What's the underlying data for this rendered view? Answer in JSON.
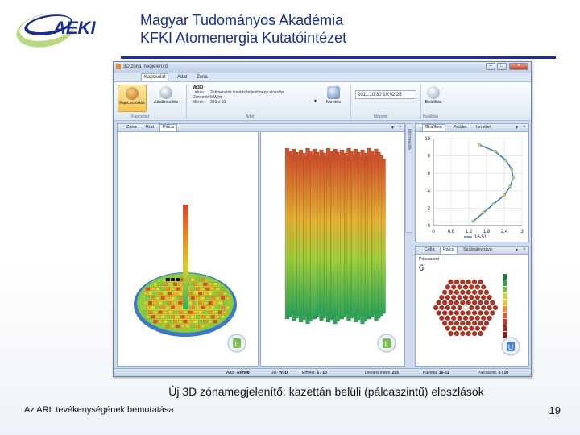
{
  "slide": {
    "logo_text": "AEKI",
    "title_line1": "Magyar Tudományos Akadémia",
    "title_line2": "KFKI Atomenergia Kutatóintézet",
    "caption": "Új 3D zónamegjelenítő: kazettán belüli (pálcaszintű) eloszlások",
    "footer_left": "Az ARL tevékenységének bemutatása",
    "page_number": "19"
  },
  "app": {
    "window_title": "3D zóna megjelenítő",
    "window_buttons": {
      "minimize": "–",
      "maximize": "□",
      "close": "×"
    },
    "menu": {
      "tabs": [
        "Kapcsolat",
        "Adat",
        "Zóna"
      ],
      "active_index": 0
    },
    "ribbon": {
      "kapcsolat_button": "Kapcsolódás",
      "kapcsolat_button2": "Adatfrissítés",
      "w3d": {
        "title": "W3D",
        "leiras_key": "Leírás:",
        "leiras_val": "3 dimenziós lineáris teljesítmény eloszlás",
        "dimenzio_key": "Dimenzió:",
        "dimenzio_val": "MW/m",
        "meret_key": "Méret:",
        "meret_val": "349 x 10"
      },
      "save_button": "Mentés",
      "timestamp": "2011.10.30 10:02:28",
      "settings_button": "Beállítás",
      "groups": [
        "Kapcsolat",
        "Adat",
        "Időpont",
        "Beállítás"
      ]
    },
    "view_tabs": {
      "items": [
        "Zóna",
        "Rúd",
        "Pálca"
      ],
      "active_index": 2
    },
    "graph_tabs": {
      "items": [
        "Grafikon",
        "Felület",
        "Ismétel"
      ],
      "active_index": 0
    },
    "map_tabs": {
      "items": [
        "Cella",
        "Pálca",
        "Szabványozva"
      ],
      "active_index": 1
    },
    "side_strip": "Információk",
    "view_badge": "L",
    "map_badge": "U",
    "map_panel": {
      "label": "Pálcaszint",
      "value": "6"
    },
    "statusbar": {
      "adat_key": "Adat:",
      "adat_val": "RPh08",
      "jel_key": "Jel:",
      "jel_val": "W3D",
      "emelet_key": "Emelet:",
      "emelet_val": "6 / 10",
      "linear_key": "Lineáris index:",
      "linear_val": "255",
      "kazetta_key": "Kazetta:",
      "kazetta_val": "16-51",
      "palca_key": "Pálcaszint:",
      "palca_val": "6 / 10"
    }
  },
  "colors": {
    "title_blue": "#1b2f8f",
    "series_line": "#3b7fc4",
    "marker": "#b7d77a"
  },
  "chart_data": {
    "type": "line",
    "title": "",
    "xlabel": "",
    "ylabel": "",
    "xlim": [
      0,
      3
    ],
    "ylim": [
      0,
      10
    ],
    "x_ticks": [
      "0",
      "0,6",
      "1,2",
      "1,8",
      "2,4",
      "3"
    ],
    "y_ticks": [
      "0",
      "2",
      "4",
      "6",
      "8",
      "10"
    ],
    "grid": true,
    "legend": "bottom",
    "series": [
      {
        "name": "16-51",
        "x": [
          1.35,
          1.7,
          2.05,
          2.4,
          2.6,
          2.7,
          2.65,
          2.45,
          2.1,
          1.55
        ],
        "y": [
          0.5,
          1.5,
          2.5,
          3.5,
          4.5,
          5.5,
          6.5,
          7.5,
          8.5,
          9.3
        ]
      }
    ]
  }
}
